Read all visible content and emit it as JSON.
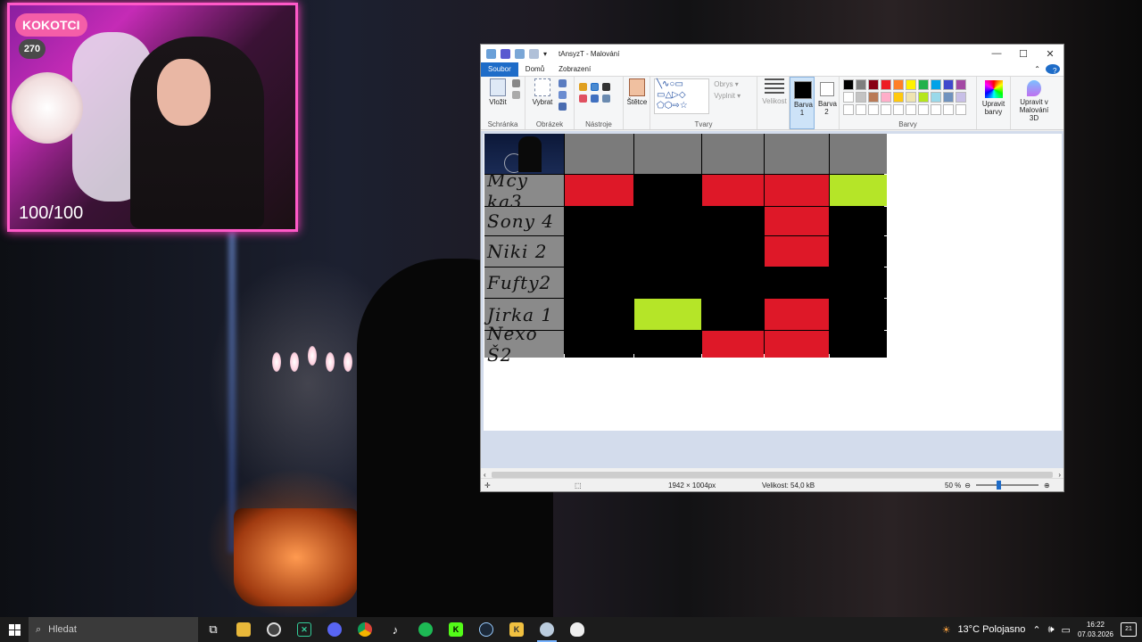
{
  "overlay": {
    "badge": "KOKOTCI",
    "count": "270",
    "score": "100/100"
  },
  "paint": {
    "title": "tAnsyzT - Malování",
    "window_controls": {
      "minimize": "—",
      "maximize": "☐",
      "close": "✕"
    },
    "tabs": [
      "Soubor",
      "Domů",
      "Zobrazení"
    ],
    "groups": {
      "clipboard": {
        "paste": "Vložit",
        "label": "Schránka"
      },
      "image": {
        "select": "Vybrat",
        "label": "Obrázek"
      },
      "tools": {
        "label": "Nástroje"
      },
      "brushes": {
        "label": "Štětce"
      },
      "shapes": {
        "outline": "Obrys",
        "fill": "Vyplnit",
        "label": "Tvary"
      },
      "size": {
        "label": "Velikost"
      },
      "color1": "Barva 1",
      "color2": "Barva 2",
      "colors": {
        "edit": "Upravit barvy",
        "label": "Barvy"
      },
      "paint3d": "Upravit v Malování 3D"
    },
    "palette": [
      "#000000",
      "#7f7f7f",
      "#880015",
      "#ed1c24",
      "#ff7f27",
      "#fff200",
      "#22b14c",
      "#00a2e8",
      "#3f48cc",
      "#a349a4",
      "#ffffff",
      "#c3c3c3",
      "#b97a57",
      "#ffaec9",
      "#ffc90e",
      "#efe4b0",
      "#b5e61d",
      "#99d9ea",
      "#7092be",
      "#c8bfe7",
      "#ffffff",
      "#ffffff",
      "#ffffff",
      "#ffffff",
      "#ffffff",
      "#ffffff",
      "#ffffff",
      "#ffffff",
      "#ffffff",
      "#ffffff"
    ],
    "status": {
      "dimensions": "1942 × 1004px",
      "size": "Velikost: 54,0 kB",
      "zoom": "50 %"
    }
  },
  "board": {
    "names": [
      "Mcy ka3",
      "Sony 4",
      "Niki 2",
      "Fufty2",
      "Jirka 1",
      "Nexo Š2"
    ],
    "rows": [
      [
        "red",
        "black",
        "red",
        "red",
        "green"
      ],
      [
        "black",
        "black",
        "black",
        "red",
        "black"
      ],
      [
        "black",
        "black",
        "black",
        "red",
        "black"
      ],
      [
        "black",
        "black",
        "black",
        "black",
        "black"
      ],
      [
        "black",
        "green",
        "black",
        "red",
        "black"
      ],
      [
        "black",
        "black",
        "red",
        "red",
        "black"
      ]
    ]
  },
  "taskbar": {
    "search": "Hledat",
    "weather": "13°C Polojasno",
    "time": "16:22",
    "date": "07.03.2026",
    "notifications": "21"
  }
}
